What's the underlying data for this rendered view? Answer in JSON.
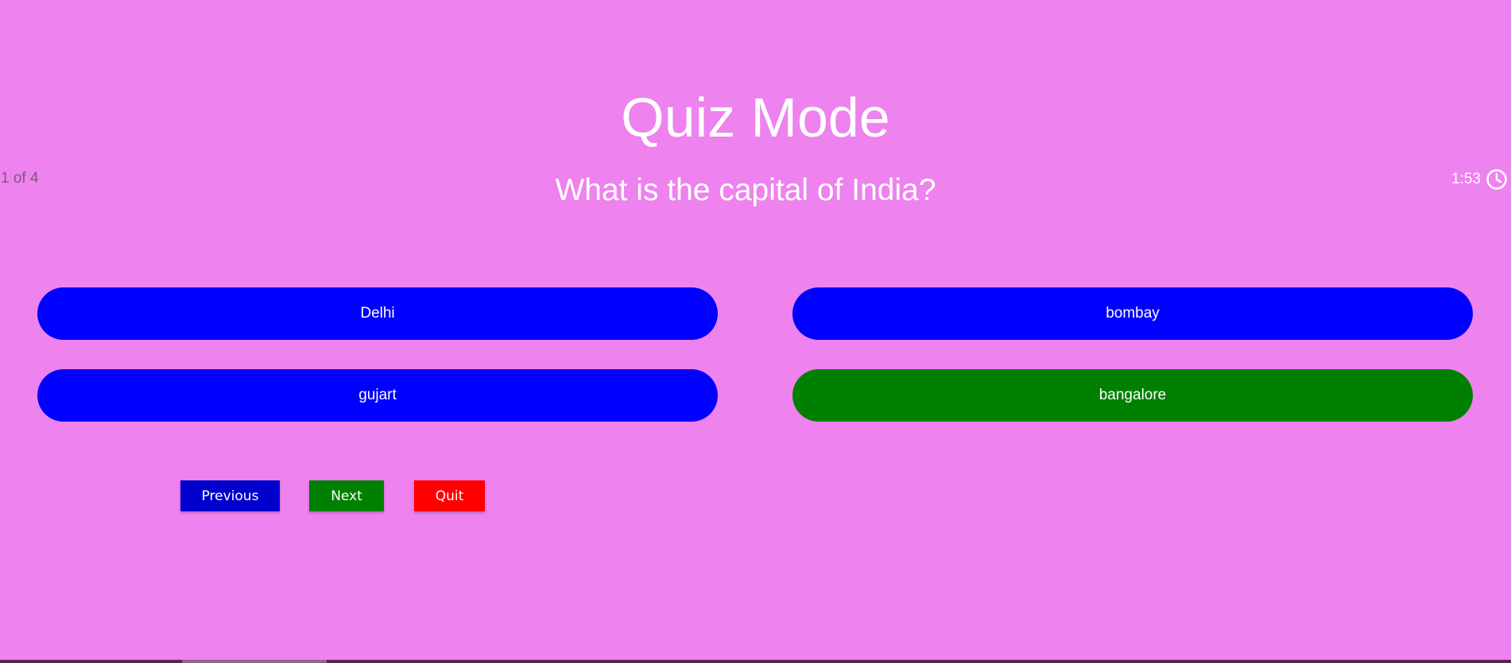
{
  "header": {
    "title": "Quiz Mode"
  },
  "quiz": {
    "counter": "1 of 4",
    "question": "What is the capital of India?",
    "timer": "1:53",
    "timer_icon": "clock-icon",
    "options": [
      {
        "label": "Delhi",
        "color": "#0000ff"
      },
      {
        "label": "bombay",
        "color": "#0000ff"
      },
      {
        "label": "gujart",
        "color": "#0000ff"
      },
      {
        "label": "bangalore",
        "color": "#008000"
      }
    ]
  },
  "controls": {
    "previous_label": "Previous",
    "next_label": "Next",
    "quit_label": "Quit"
  },
  "colors": {
    "background": "#ee82ee",
    "option_default": "#0000ff",
    "option_selected": "#008000",
    "previous": "#0000cd",
    "next": "#008000",
    "quit": "#ff0000"
  }
}
